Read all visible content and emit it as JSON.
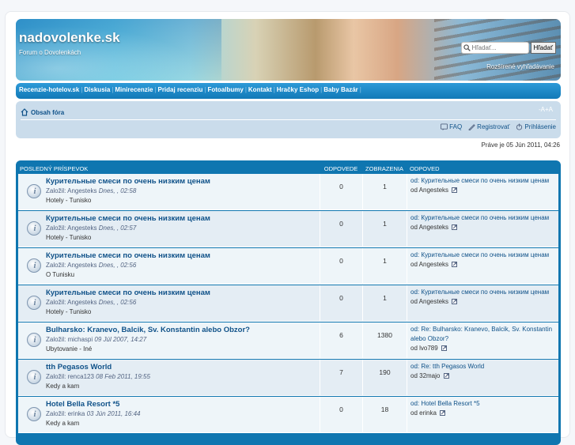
{
  "header": {
    "site_title": "nadovolenke.sk",
    "site_desc": "Forum o Dovolenkách",
    "search_placeholder": "Hľadať...",
    "search_button": "Hľadať",
    "advanced_search": "Rozšírené vyhľadávanie"
  },
  "nav": {
    "items": [
      {
        "label": "Recenzie-hotelov.sk"
      },
      {
        "label": "Diskusia"
      },
      {
        "label": "Minirecenzie"
      },
      {
        "label": "Pridaj recenziu"
      },
      {
        "label": "Fotoalbumy"
      },
      {
        "label": "Kontakt"
      },
      {
        "label": "Hračky Eshop"
      },
      {
        "label": "Baby Bazár"
      }
    ],
    "separator": "|"
  },
  "breadcrumb": {
    "home": "Obsah fóra",
    "fontsize": "-A+A"
  },
  "user_links": {
    "faq": "FAQ",
    "register": "Registrovať",
    "login": "Prihlásenie"
  },
  "datetime": "Práve je 05 Jún 2011, 04:26",
  "table": {
    "headers": {
      "topic": "POSLEDNÝ PRÍSPEVOK",
      "replies": "ODPOVEDE",
      "views": "ZOBRAZENIA",
      "last": "ODPOVED"
    },
    "rows": [
      {
        "title": "Курительные смеси по очень низким ценам",
        "author_prefix": "Založil: ",
        "author": "Angesteks",
        "date": "Dnes, , 02:58",
        "forum": "Hotely - Tunisko",
        "replies": "0",
        "views": "1",
        "last_title": "od: Курительные смеси по очень низким ценам",
        "last_by": "od Angesteks"
      },
      {
        "title": "Курительные смеси по очень низким ценам",
        "author_prefix": "Založil: ",
        "author": "Angesteks",
        "date": "Dnes, , 02:57",
        "forum": "Hotely - Tunisko",
        "replies": "0",
        "views": "1",
        "last_title": "od: Курительные смеси по очень низким ценам",
        "last_by": "od Angesteks"
      },
      {
        "title": "Курительные смеси по очень низким ценам",
        "author_prefix": "Založil: ",
        "author": "Angesteks",
        "date": "Dnes, , 02:56",
        "forum": "O Tunisku",
        "replies": "0",
        "views": "1",
        "last_title": "od: Курительные смеси по очень низким ценам",
        "last_by": "od Angesteks"
      },
      {
        "title": "Курительные смеси по очень низким ценам",
        "author_prefix": "Založil: ",
        "author": "Angesteks",
        "date": "Dnes, , 02:56",
        "forum": "Hotely - Tunisko",
        "replies": "0",
        "views": "1",
        "last_title": "od: Курительные смеси по очень низким ценам",
        "last_by": "od Angesteks"
      },
      {
        "title": "Bulharsko: Kranevo, Balcik, Sv. Konstantin alebo Obzor?",
        "author_prefix": "Založil: ",
        "author": "michaspi",
        "date": "09 Júl 2007, 14:27",
        "forum": "Ubytovanie - Iné",
        "replies": "6",
        "views": "1380",
        "last_title": "od: Re: Bulharsko: Kranevo, Balcik, Sv. Konstantin alebo Obzor?",
        "last_by": "od lvo789"
      },
      {
        "title": "tth Pegasos World",
        "author_prefix": "Založil: ",
        "author": "renca123",
        "date": "08 Feb 2011, 19:55",
        "forum": "Kedy a kam",
        "replies": "7",
        "views": "190",
        "last_title": "od: Re: tth Pegasos World",
        "last_by": "od 32majo"
      },
      {
        "title": "Hotel Bella Resort *5",
        "author_prefix": "Založil: ",
        "author": "erinka",
        "date": "03 Jún 2011, 16:44",
        "forum": "Kedy a kam",
        "replies": "0",
        "views": "18",
        "last_title": "od: Hotel Bella Resort *5",
        "last_by": "od erinka"
      }
    ]
  },
  "colors": {
    "nav_bg": "#1b86c6",
    "table_bg": "#0f76b0",
    "link": "#105289",
    "panel": "#cadceb"
  }
}
